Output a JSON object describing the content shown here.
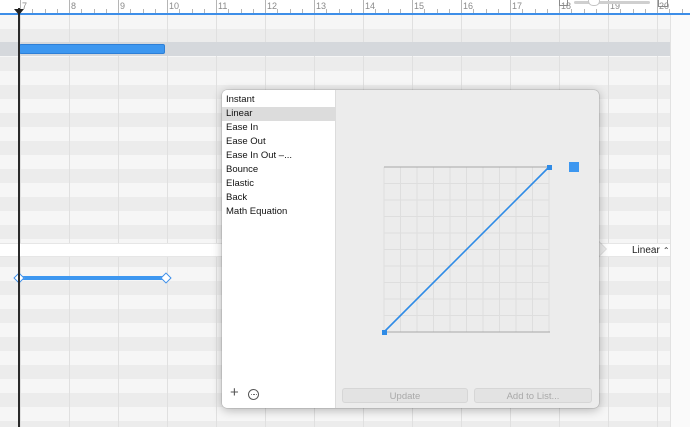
{
  "ruler": {
    "labels": [
      "7",
      "8",
      "9",
      "10",
      "11",
      "12",
      "13",
      "14",
      "15",
      "16",
      "17",
      "18",
      "19",
      "20"
    ]
  },
  "colors": {
    "accent": "#3d97f0",
    "curve": "#2f8be6"
  },
  "timeline": {
    "easing_value": "Linear"
  },
  "popover": {
    "easing_options": [
      "Instant",
      "Linear",
      "Ease In",
      "Ease Out",
      "Ease In Out –...",
      "Bounce",
      "Elastic",
      "Back",
      "Math Equation"
    ],
    "selected_option": "Linear",
    "add_icon": "plus-icon",
    "more_icon": "ellipsis-circle-icon",
    "update_label": "Update",
    "add_to_list_label": "Add to List..."
  }
}
